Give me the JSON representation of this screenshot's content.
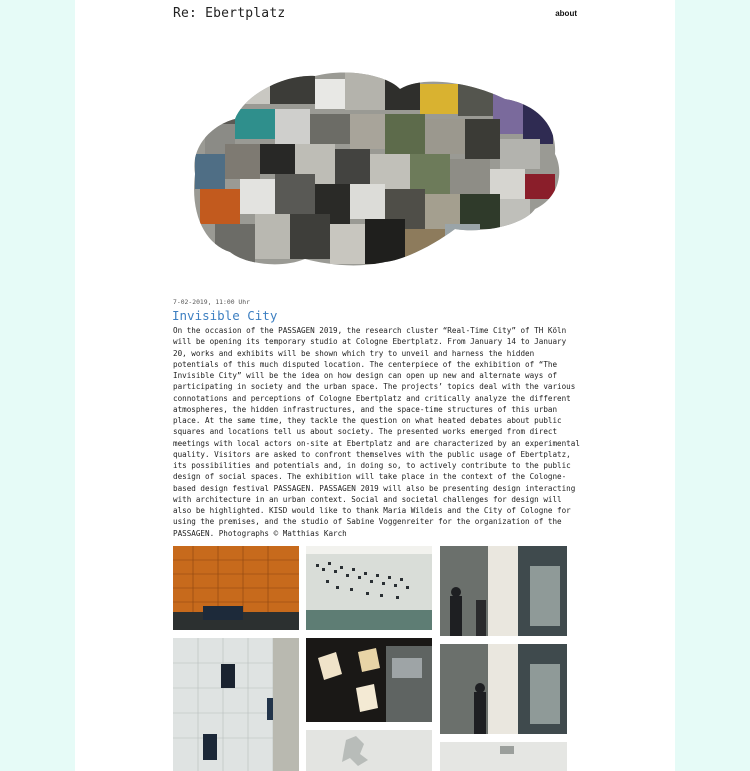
{
  "header": {
    "site_title": "Re: Ebertplatz",
    "about_label": "about"
  },
  "post": {
    "date": "7-02-2019, 11:00 Uhr",
    "title": "Invisible City",
    "body": "On the occasion of the PASSAGEN 2019, the research cluster “Real-Time City” of TH Köln will be opening its temporary studio at Cologne Ebertplatz. From January 14 to January 20, works and exhibits will be shown which try to unveil and harness the hidden potentials of this much disputed location. The centerpiece of the exhibition of “The Invisible City” will be the idea on how design can open up new and alternate ways of participating in society and the urban space. The projects’ topics deal with the various connotations and perceptions of Cologne Ebertplatz and critically analyze the different atmospheres, the hidden infrastructures, and the space-time structures of this urban place. At the same time, they tackle the question on what heated debates about public squares and locations tell us about society. The presented works emerged from direct meetings with local actors on-site at Ebertplatz and are characterized by an experimental quality. Visitors are asked to confront themselves with the public usage of Ebertplatz, its possibilities and potentials and, in doing so, to actively contribute to the public design of social spaces. The exhibition will take place in the context of the Cologne-based design festival PASSAGEN. PASSAGEN 2019 will also be presenting design interacting with architecture in an urban context. Social and societal challenges for design will also be highlighted. KISD would like to thank Maria Wildeis and the City of Cologne for using the premises, and the studio of Sabine Voggenreiter for the organization of the PASSAGEN. Photographs © Matthias Karch"
  },
  "colors": {
    "background": "#e6fbf7",
    "page": "#ffffff",
    "title_link": "#3d7fc1"
  },
  "gallery": [
    {
      "subject": "orange-tiled-wall-photo"
    },
    {
      "subject": "wall-map-installation-photo"
    },
    {
      "subject": "gallery-visitors-photo"
    },
    {
      "subject": "white-tile-screens-photo"
    },
    {
      "subject": "dark-light-boxes-photo"
    },
    {
      "subject": "gallery-visitors-photo-2"
    },
    {
      "subject": "floor-map-photo"
    },
    {
      "subject": "white-wall-photo"
    }
  ]
}
